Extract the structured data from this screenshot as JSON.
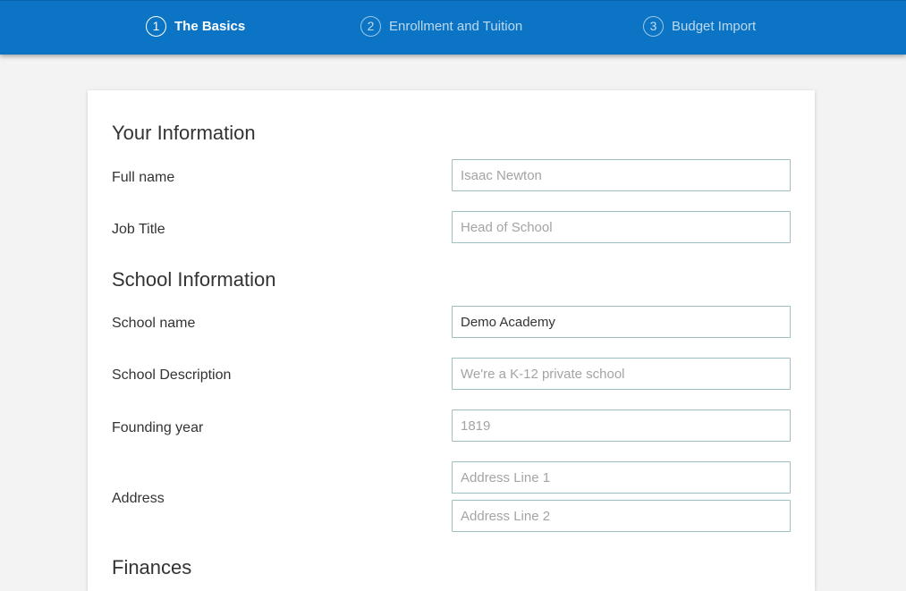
{
  "steps": [
    {
      "number": "1",
      "label": "The Basics"
    },
    {
      "number": "2",
      "label": "Enrollment and Tuition"
    },
    {
      "number": "3",
      "label": "Budget Import"
    }
  ],
  "your_info": {
    "title": "Your Information",
    "full_name": {
      "label": "Full name",
      "placeholder": "Isaac Newton"
    },
    "job_title": {
      "label": "Job Title",
      "placeholder": "Head of School"
    }
  },
  "school_info": {
    "title": "School Information",
    "school_name": {
      "label": "School name",
      "value": "Demo Academy"
    },
    "school_description": {
      "label": "School Description",
      "placeholder": "We're a K-12 private school"
    },
    "founding_year": {
      "label": "Founding year",
      "placeholder": "1819"
    },
    "address": {
      "label": "Address",
      "line1_placeholder": "Address Line 1",
      "line2_placeholder": "Address Line 2"
    }
  },
  "finances": {
    "title": "Finances"
  }
}
